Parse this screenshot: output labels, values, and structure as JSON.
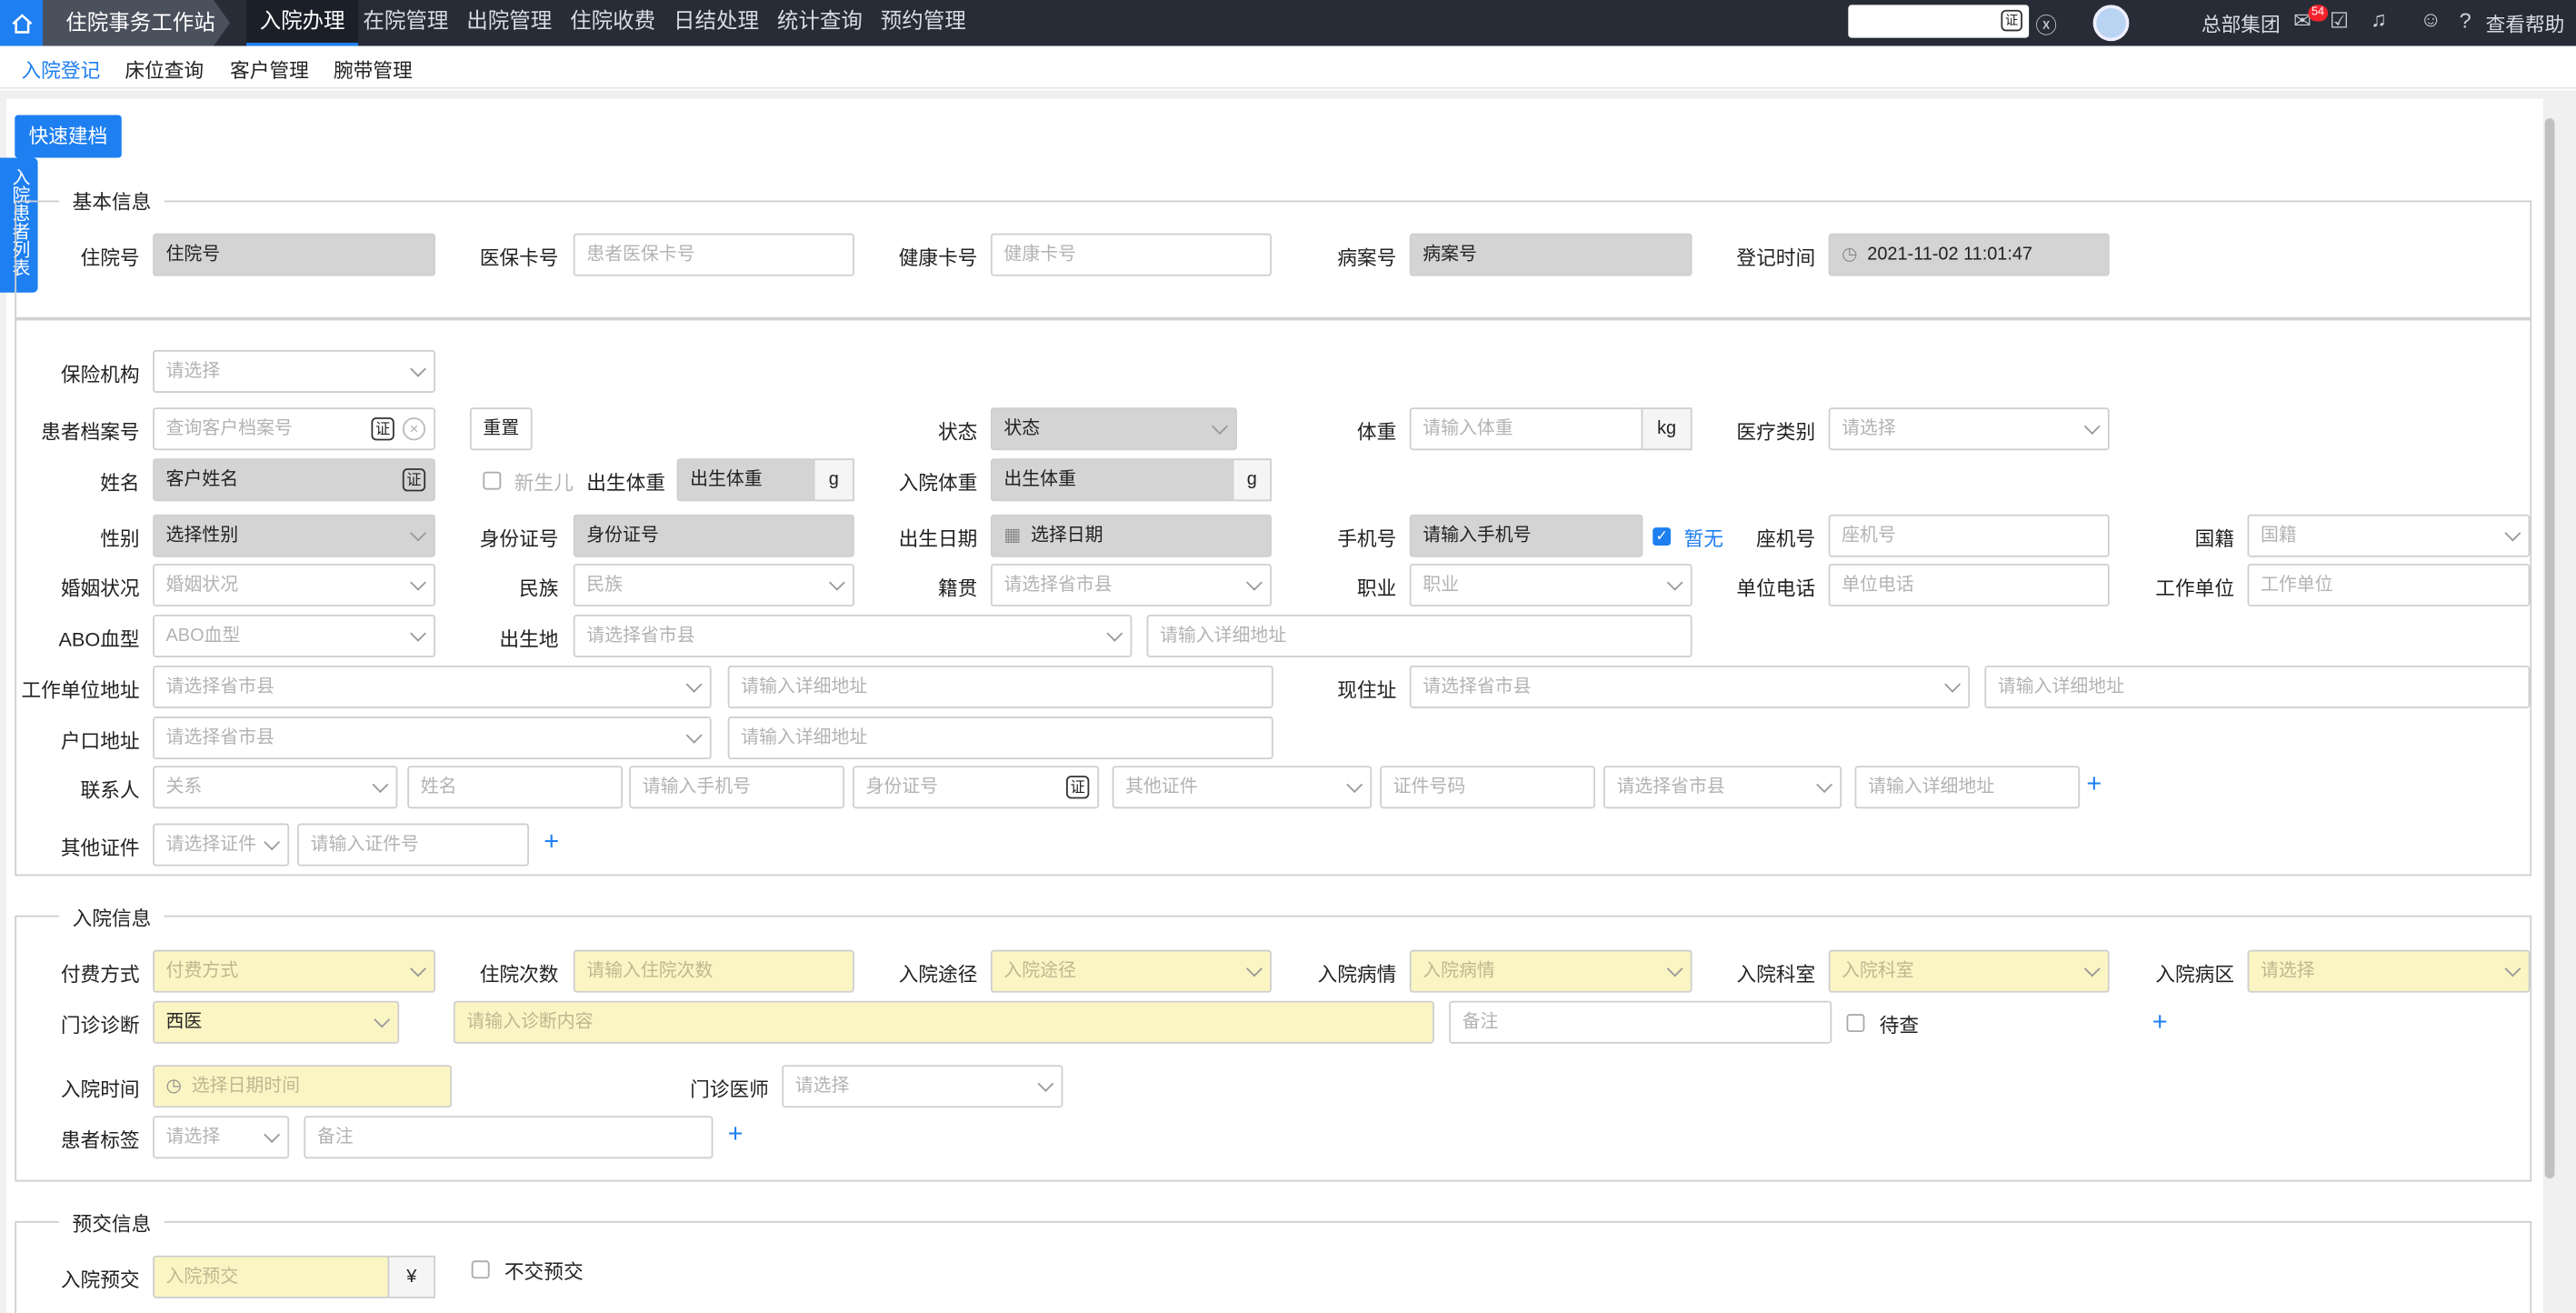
{
  "top": {
    "workstation": "住院事务工作站",
    "menu": [
      "入院办理",
      "在院管理",
      "出院管理",
      "住院收费",
      "日结处理",
      "统计查询",
      "预约管理"
    ],
    "org": "总部集团",
    "badge": "54",
    "help": "查看帮助"
  },
  "subnav": [
    "入院登记",
    "床位查询",
    "客户管理",
    "腕带管理"
  ],
  "quick_button": "快速建档",
  "side_tab": "入院患者列表",
  "basic": {
    "legend": "基本信息",
    "inpatient_no_label": "住院号",
    "inpatient_no": "住院号",
    "medical_card_label": "医保卡号",
    "medical_card_ph": "患者医保卡号",
    "health_card_label": "健康卡号",
    "health_card_ph": "健康卡号",
    "case_no_label": "病案号",
    "case_no": "病案号",
    "reg_time_label": "登记时间",
    "reg_time": "2021-11-02 11:01:47"
  },
  "patient": {
    "insurer_label": "保险机构",
    "insurer_ph": "请选择",
    "file_no_label": "患者档案号",
    "file_no_ph": "查询客户档案号",
    "reset": "重置",
    "status_label": "状态",
    "status": "状态",
    "weight_label": "体重",
    "weight_ph": "请输入体重",
    "weight_unit": "kg",
    "med_type_label": "医疗类别",
    "med_type_ph": "请选择",
    "name_label": "姓名",
    "name": "客户姓名",
    "newborn": "新生儿",
    "birth_weight_label": "出生体重",
    "birth_weight": "出生体重",
    "birth_weight_unit": "g",
    "adm_weight_label": "入院体重",
    "adm_weight": "出生体重",
    "adm_weight_unit": "g",
    "gender_label": "性别",
    "gender": "选择性别",
    "id_label": "身份证号",
    "id": "身份证号",
    "dob_label": "出生日期",
    "dob": "选择日期",
    "phone_label": "手机号",
    "phone": "请输入手机号",
    "none_label": "暂无",
    "landline_label": "座机号",
    "landline_ph": "座机号",
    "nationality_label": "国籍",
    "nationality_ph": "国籍",
    "marital_label": "婚姻状况",
    "marital_ph": "婚姻状况",
    "ethnic_label": "民族",
    "ethnic_ph": "民族",
    "native_label": "籍贯",
    "native_ph": "请选择省市县",
    "job_label": "职业",
    "job_ph": "职业",
    "work_phone_label": "单位电话",
    "work_phone_ph": "单位电话",
    "work_unit_label": "工作单位",
    "work_unit_ph": "工作单位",
    "abo_label": "ABO血型",
    "abo_ph": "ABO血型",
    "birthplace_label": "出生地",
    "birthplace_ph": "请选择省市县",
    "birthplace_addr_ph": "请输入详细地址",
    "work_addr_label": "工作单位地址",
    "work_addr_ph": "请选择省市县",
    "work_addr_detail_ph": "请输入详细地址",
    "current_addr_label": "现住址",
    "current_addr_ph": "请选择省市县",
    "current_addr_detail_ph": "请输入详细地址",
    "hukou_label": "户口地址",
    "hukou_ph": "请选择省市县",
    "hukou_detail_ph": "请输入详细地址",
    "contact_label": "联系人",
    "contact_rel_ph": "关系",
    "contact_name_ph": "姓名",
    "contact_phone_ph": "请输入手机号",
    "contact_id_ph": "身份证号",
    "contact_other_ph": "其他证件",
    "contact_cert_no_ph": "证件号码",
    "contact_region_ph": "请选择省市县",
    "contact_addr_ph": "请输入详细地址",
    "other_cert_label": "其他证件",
    "other_cert_ph": "请选择证件",
    "other_cert_no_ph": "请输入证件号"
  },
  "admission": {
    "legend": "入院信息",
    "pay_label": "付费方式",
    "pay_ph": "付费方式",
    "times_label": "住院次数",
    "times_ph": "请输入住院次数",
    "route_label": "入院途径",
    "route_ph": "入院途径",
    "condition_label": "入院病情",
    "condition_ph": "入院病情",
    "dept_label": "入院科室",
    "dept_ph": "入院科室",
    "ward_label": "入院病区",
    "ward_ph": "请选择",
    "diag_label": "门诊诊断",
    "diag_type": "西医",
    "diag_ph": "请输入诊断内容",
    "diag_note_ph": "备注",
    "pending": "待查",
    "time_label": "入院时间",
    "time_ph": "选择日期时间",
    "doctor_label": "门诊医师",
    "doctor_ph": "请选择",
    "tag_label": "患者标签",
    "tag_ph": "请选择",
    "tag_note_ph": "备注"
  },
  "prepay": {
    "legend": "预交信息",
    "label": "入院预交",
    "ph": "入院预交",
    "unit": "¥",
    "no_prepay": "不交预交"
  }
}
